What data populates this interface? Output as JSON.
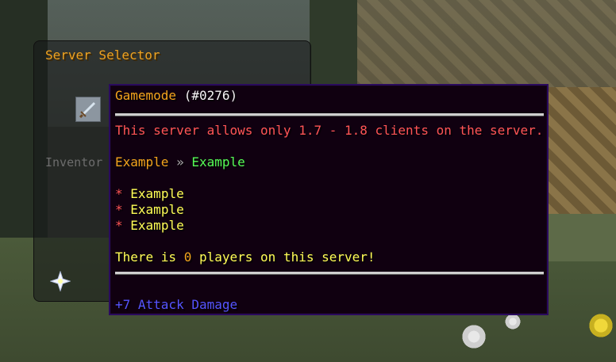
{
  "selector": {
    "title": "Server Selector",
    "inventory_hint": "Inventor"
  },
  "tooltip": {
    "name": "Gamemode",
    "id": "(#0276)",
    "version_notice": "This server allows only 1.7 - 1.8 clients on the server.",
    "route": {
      "from": "Example",
      "separator": "»",
      "to": "Example"
    },
    "bullets": [
      {
        "marker": "*",
        "text": "Example"
      },
      {
        "marker": "*",
        "text": "Example"
      },
      {
        "marker": "*",
        "text": "Example"
      }
    ],
    "players": {
      "prefix": "There is",
      "count": "0",
      "suffix": "players on this server!"
    },
    "attribute": "+7 Attack Damage"
  },
  "colors": {
    "gold": "#f2a51c",
    "red": "#ff5555",
    "green": "#55ff55",
    "yellow": "#ffff55",
    "blue": "#5555ff",
    "tooltip_bg": "#100010",
    "tooltip_border": "#2a0a5e"
  },
  "icons": {
    "sword": "diamond-sword-icon",
    "star": "nether-star-icon"
  }
}
